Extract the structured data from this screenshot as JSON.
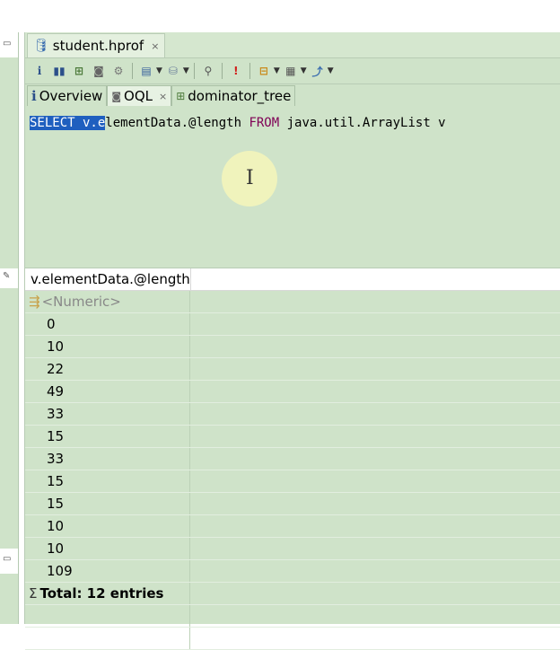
{
  "editor": {
    "file_tab": "student.hprof",
    "close_glyph": "×"
  },
  "subtabs": [
    {
      "icon": "i",
      "label": "Overview"
    },
    {
      "icon": "oql",
      "label": "OQL"
    },
    {
      "icon": "tree",
      "label": "dominator_tree"
    }
  ],
  "query": {
    "selected": "SELECT v.e",
    "rest_before_from": "lementData.@length ",
    "from_kw": "FROM",
    "rest_after_from": " java.util.ArrayList v"
  },
  "results": {
    "column_header": "v.elementData.@length",
    "type_row": "<Numeric>",
    "values": [
      "0",
      "10",
      "22",
      "49",
      "33",
      "15",
      "33",
      "15",
      "15",
      "10",
      "10",
      "109"
    ],
    "total_label": "Total: 12 entries"
  },
  "colors": {
    "panel_bg": "#cfe3c9",
    "selection": "#1f5fbf",
    "keyword": "#7f0055"
  }
}
